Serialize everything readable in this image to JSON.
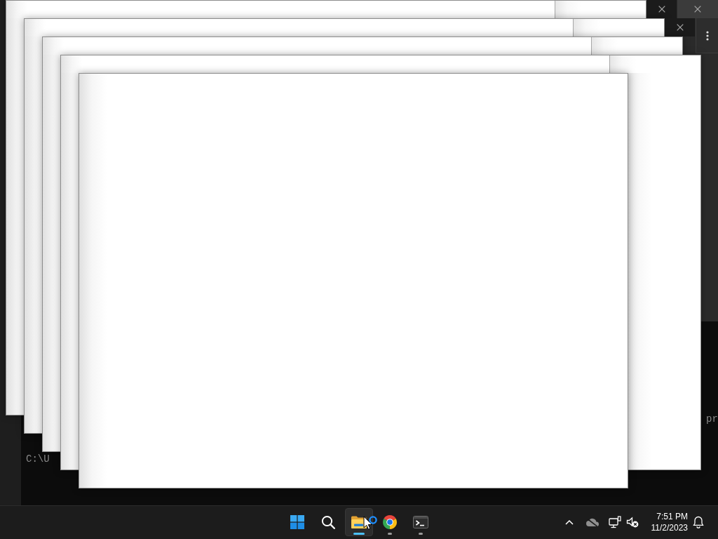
{
  "terminal": {
    "lines": [
      {
        "text": "pr"
      },
      {
        "text": "C:\\U"
      }
    ]
  },
  "windows": [
    {
      "kind": "frame",
      "close_button": true
    },
    {
      "kind": "frame",
      "close_button": true
    },
    {
      "kind": "frame",
      "close_button": false
    },
    {
      "kind": "frame",
      "close_button": false
    },
    {
      "kind": "plain",
      "close_button": false
    }
  ],
  "taskbar": {
    "apps": [
      {
        "kind": "start",
        "selected": false,
        "running": false
      },
      {
        "kind": "search",
        "selected": false,
        "running": false
      },
      {
        "kind": "folder",
        "selected": true,
        "running": true
      },
      {
        "kind": "browser",
        "selected": false,
        "running": true
      },
      {
        "kind": "terminal",
        "selected": false,
        "running": true
      }
    ],
    "tray": [
      {
        "kind": "chevron"
      },
      {
        "kind": "cloud-off"
      },
      {
        "kind": "network"
      },
      {
        "kind": "volume-muted"
      },
      {
        "kind": "clock",
        "time": "7:51 PM",
        "date": "11/2/2023"
      },
      {
        "kind": "bell"
      }
    ]
  },
  "pointer": {
    "busy": true
  }
}
